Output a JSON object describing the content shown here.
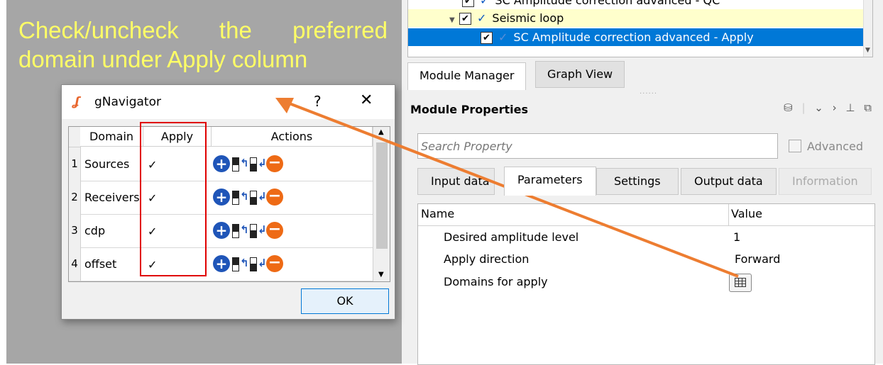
{
  "caption": {
    "line1": "Check/uncheck the preferred",
    "line2": "domain under Apply column"
  },
  "tree": {
    "rows": [
      {
        "label": "SC Amplitude correction advanced - QC",
        "checked": true
      },
      {
        "label": "Seismic loop",
        "checked": true
      },
      {
        "label": "SC Amplitude correction advanced - Apply",
        "checked": true,
        "selected": true
      }
    ]
  },
  "panel_tabs": {
    "module_manager": "Module Manager",
    "graph_view": "Graph View"
  },
  "module_properties": {
    "title": "Module Properties",
    "search_placeholder": "Search Property",
    "advanced": "Advanced",
    "tabs": [
      "Input data",
      "Parameters",
      "Settings",
      "Output data",
      "Information"
    ],
    "columns": {
      "name": "Name",
      "value": "Value"
    },
    "params": [
      {
        "name": "Desired amplitude level",
        "value": "1"
      },
      {
        "name": "Apply direction",
        "value": "Forward"
      },
      {
        "name": "Domains for apply",
        "value": ""
      }
    ]
  },
  "dialog": {
    "title": "gNavigator",
    "help": "?",
    "close": "✕",
    "columns": {
      "domain": "Domain",
      "apply": "Apply",
      "actions": "Actions"
    },
    "rows": [
      {
        "num": "1",
        "domain": "Sources",
        "apply": "✓"
      },
      {
        "num": "2",
        "domain": "Receivers",
        "apply": "✓"
      },
      {
        "num": "3",
        "domain": "cdp",
        "apply": "✓"
      },
      {
        "num": "4",
        "domain": "offset",
        "apply": "✓"
      }
    ],
    "ok": "OK"
  },
  "colors": {
    "caption": "#ffff66",
    "arrow": "#ed7d31",
    "highlight_box": "#e00000",
    "selection": "#0078d7"
  }
}
